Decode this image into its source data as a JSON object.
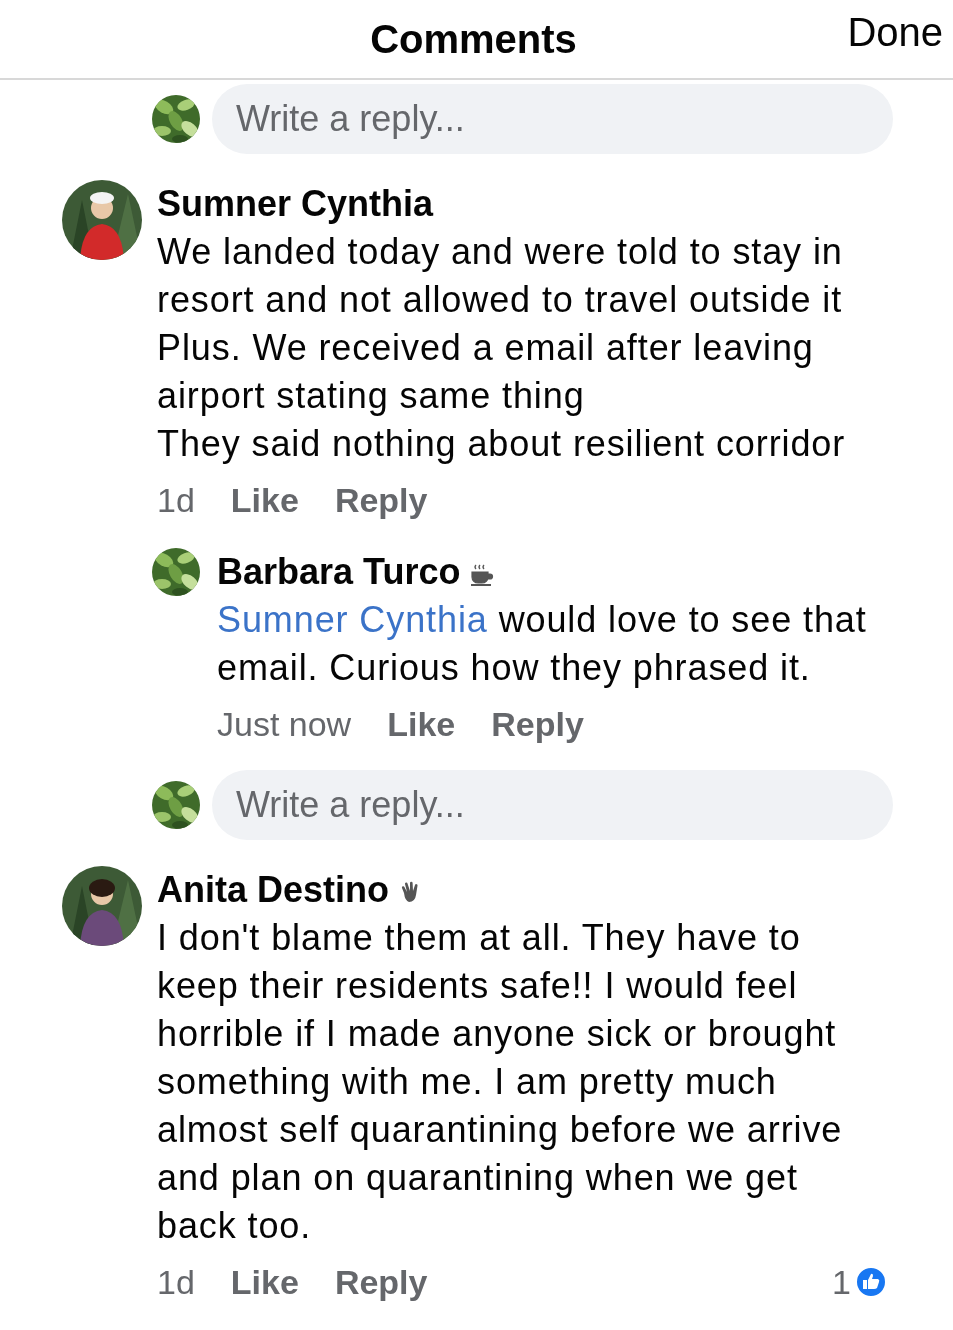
{
  "header": {
    "title": "Comments",
    "done": "Done"
  },
  "items": [
    {
      "kind": "reply_field",
      "placeholder": "Write a reply..."
    },
    {
      "kind": "comment",
      "author": "Sumner Cynthia",
      "text": "We landed today and were told to stay in resort and not allowed to travel outside it\nPlus. We received a email after leaving airport stating same thing\nThey said nothing about resilient corridor",
      "time": "1d",
      "actions": [
        "Like",
        "Reply"
      ]
    },
    {
      "kind": "reply",
      "author": "Barbara Turco",
      "badge": {
        "kind": "cup"
      },
      "mention": "Sumner Cynthia",
      "text": "would love to see that email. Curious how they phrased it.",
      "time": "Just now",
      "actions": [
        "Like",
        "Reply"
      ]
    },
    {
      "kind": "reply_field",
      "placeholder": "Write a reply..."
    },
    {
      "kind": "comment",
      "author": "Anita Destino",
      "badge": {
        "kind": "hand"
      },
      "text": "I don't blame them at all. They have to keep their residents safe!! I would feel horrible if I made anyone sick or brought something with me. I am pretty much almost self quarantining before we arrive and plan on quarantining when we get back too.",
      "time": "1d",
      "actions": [
        "Like",
        "Reply"
      ],
      "reaction_count": "1"
    }
  ]
}
